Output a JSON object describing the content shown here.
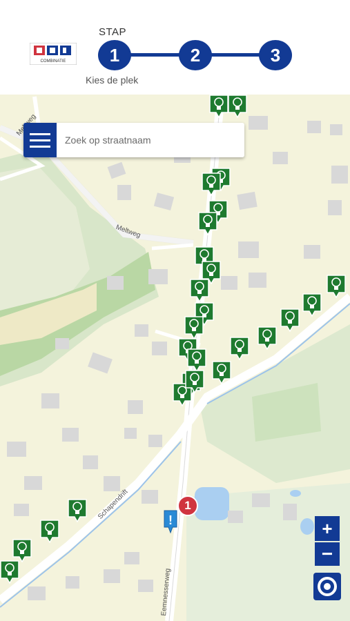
{
  "header": {
    "logo_label": "COMBINATIE",
    "step_label": "STAP",
    "steps": [
      "1",
      "2",
      "3"
    ],
    "step_caption": "Kies de plek"
  },
  "search": {
    "placeholder": "Zoek op straatnaam"
  },
  "map": {
    "streets": [
      "Meltweg",
      "Meltweg",
      "Schapendrift",
      "Eemnesserweg"
    ],
    "report_badge": "1",
    "report_icon": "!",
    "zoom_in": "+",
    "zoom_out": "−"
  },
  "colors": {
    "primary": "#123a94",
    "marker_green": "#1e7a2f",
    "badge_red": "#d0343f"
  }
}
